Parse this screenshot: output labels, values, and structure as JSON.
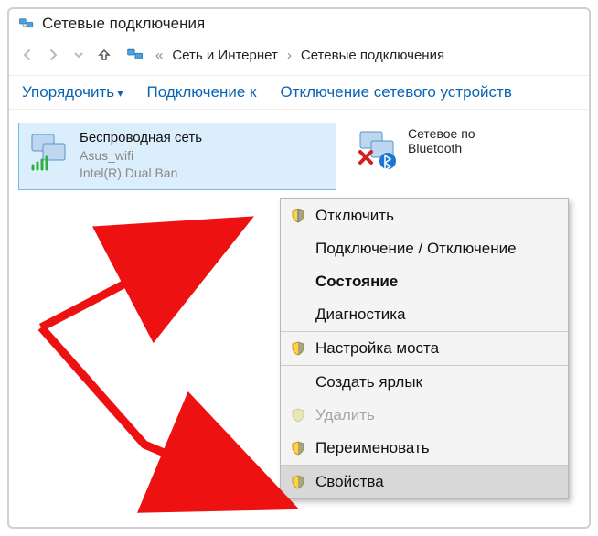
{
  "window": {
    "title": "Сетевые подключения"
  },
  "breadcrumb": {
    "prefix": "«",
    "seg1": "Сеть и Интернет",
    "sep": "›",
    "seg2": "Сетевые подключения"
  },
  "toolbar": {
    "organise": "Упорядочить",
    "connect_to": "Подключение к",
    "disable_device": "Отключение сетевого устройств"
  },
  "items": [
    {
      "name": "Беспроводная сеть",
      "line2": "Asus_wifi",
      "line3": "Intel(R) Dual Ban"
    },
    {
      "name": "Сетевое по",
      "line2": "Bluetooth"
    }
  ],
  "ctx": {
    "disable": "Отключить",
    "conn_disc": "Подключение / Отключение",
    "status": "Состояние",
    "diagnostics": "Диагностика",
    "bridge": "Настройка моста",
    "shortcut": "Создать ярлык",
    "delete": "Удалить",
    "rename": "Переименовать",
    "properties": "Свойства"
  }
}
